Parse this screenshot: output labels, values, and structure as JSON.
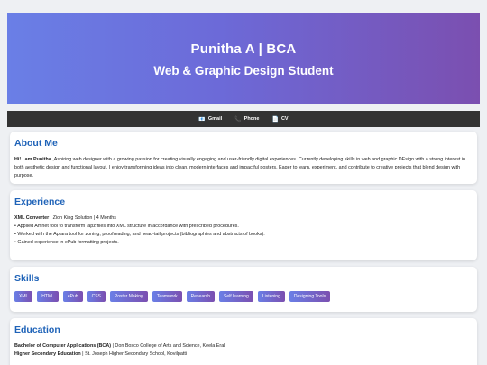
{
  "header": {
    "name_line": "Punitha A | BCA",
    "role_line": "Web & Graphic Design Student"
  },
  "nav": {
    "items": [
      {
        "icon": "📧",
        "label": "Gmail",
        "icon_name": "mail-icon"
      },
      {
        "icon": "📞",
        "label": "Phone",
        "icon_name": "phone-icon"
      },
      {
        "icon": "📄",
        "label": "CV",
        "icon_name": "document-icon"
      }
    ]
  },
  "about": {
    "title": "About Me",
    "intro_bold": "Hi! I am Punitha",
    "text": " ,Aspiring web designer with a growing passion for creating visually engaging and user-friendly digital experiences. Currently developing skills in web and graphic DEsign with a strong interest in both aesthetic design and functional layout. I enjoy transforming ideas into clean, modern interfaces and impactful posters. Eager to learn, experiment, and contribute to creative projects that blend design with purpose."
  },
  "experience": {
    "title": "Experience",
    "role": "XML Converter",
    "company_line": " | Zion King Solution | 4 Months",
    "bullets": [
      "• Applied Amnet tool to transform .apz files into XML structure in accordance with prescribed procedures.",
      "• Worked with the Aptara tool for zoning, proofreading, and head-tail projects (bibliographies and abstracts of books).",
      "• Gained experience in ePub formatting projects."
    ]
  },
  "skills": {
    "title": "Skills",
    "tags": [
      "XML",
      "HTML",
      "ePub",
      "CSS",
      "Poster Making",
      "Teamwork",
      "Research",
      "Self learning",
      "Listening",
      "Designing Tools"
    ]
  },
  "education": {
    "title": "Education",
    "entries": [
      {
        "degree": "Bachelor of Computer Applications (BCA)",
        "school": " | Don Bosco College of Arts and Science, Keela Eral"
      },
      {
        "degree": "Higher Secondary Education",
        "school": " | St. Joseph Higher Secondary School, Kovilpatti"
      }
    ]
  },
  "colors": {
    "accent": "#1f63b8",
    "gradient_start": "#6a7fe6",
    "gradient_end": "#7b4fb0",
    "navbar": "#333333"
  }
}
